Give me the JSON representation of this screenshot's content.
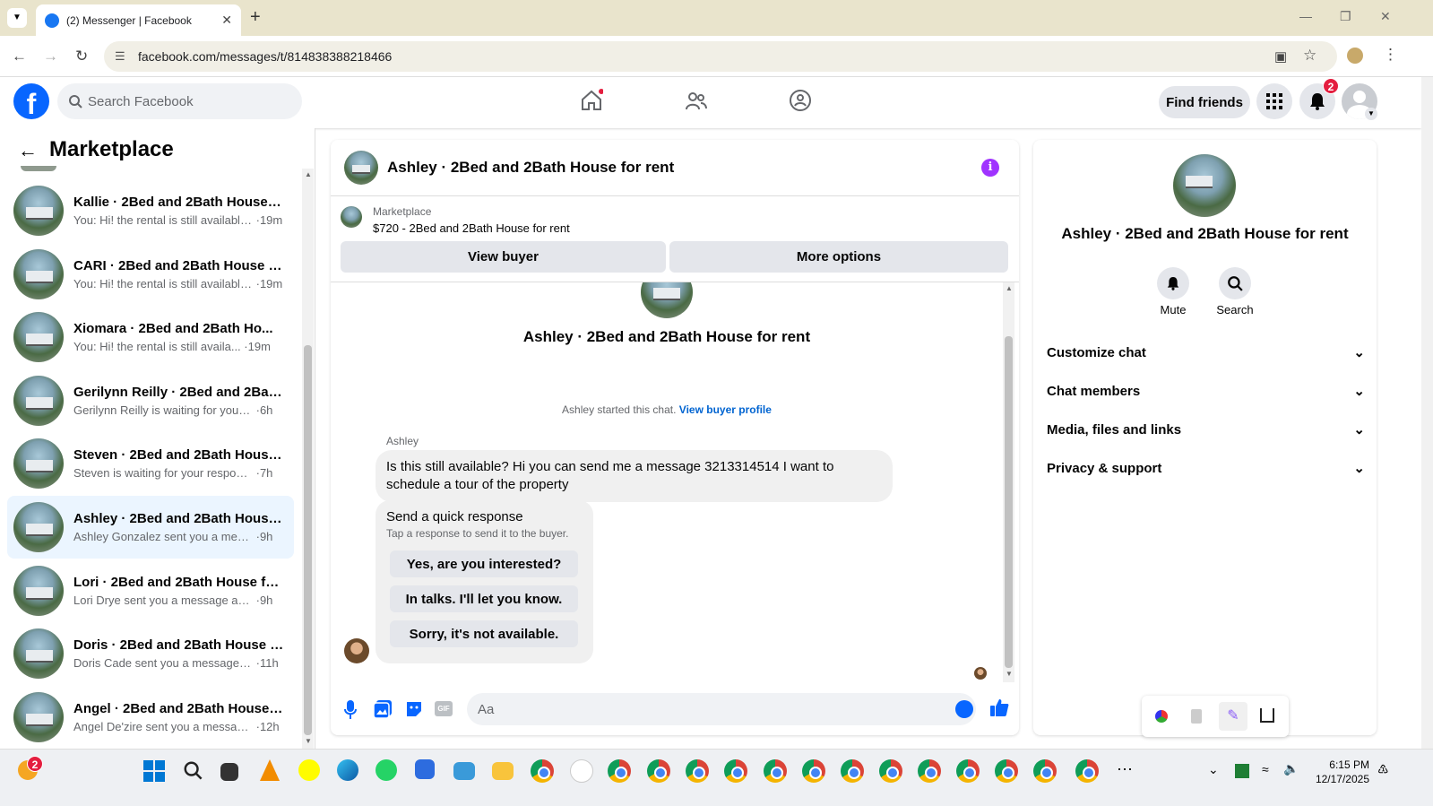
{
  "browser": {
    "tab_title": "(2) Messenger | Facebook",
    "url": "facebook.com/messages/t/814838388218466"
  },
  "fb_header": {
    "search_placeholder": "Search Facebook",
    "find_friends": "Find friends",
    "notifications_count": "2"
  },
  "sidebar": {
    "title": "Marketplace",
    "conversations": [
      {
        "name": "Kallie · 2Bed and 2Bath House f...",
        "preview": "You: Hi! the rental is still available...",
        "time": "19m",
        "selected": false
      },
      {
        "name": "CARI · 2Bed and 2Bath House fo...",
        "preview": "You: Hi! the rental is still available...",
        "time": "19m",
        "selected": false
      },
      {
        "name": "Xiomara · 2Bed and 2Bath Ho...",
        "preview": "You: Hi! the rental is still availa...",
        "time": "19m",
        "selected": false
      },
      {
        "name": "Gerilynn Reilly · 2Bed and 2Bath...",
        "preview": "Gerilynn Reilly is waiting for your r...",
        "time": "6h",
        "selected": false
      },
      {
        "name": "Steven · 2Bed and 2Bath House ...",
        "preview": "Steven is waiting for your response.",
        "time": "7h",
        "selected": false
      },
      {
        "name": "Ashley · 2Bed and 2Bath House ...",
        "preview": "Ashley Gonzalez sent you a messa...",
        "time": "9h",
        "selected": true
      },
      {
        "name": "Lori · 2Bed and 2Bath House for...",
        "preview": "Lori Drye sent you a message abou...",
        "time": "9h",
        "selected": false
      },
      {
        "name": "Doris · 2Bed and 2Bath House f...",
        "preview": "Doris Cade sent you a message a...",
        "time": "11h",
        "selected": false
      },
      {
        "name": "Angel · 2Bed and 2Bath House f...",
        "preview": "Angel De'zire sent you a message...",
        "time": "12h",
        "selected": false
      }
    ]
  },
  "chat": {
    "title": "Ashley · 2Bed and 2Bath House for rent",
    "listing_source": "Marketplace",
    "listing": "$720 - 2Bed and 2Bath House for rent",
    "view_buyer": "View buyer",
    "more_options": "More options",
    "center_name": "Ashley · 2Bed and 2Bath House for rent",
    "started_text": "Ashley started this chat.",
    "view_buyer_profile": "View buyer profile",
    "sender": "Ashley",
    "message": "Is this still available? Hi you can send me a message 3213314514 I want to schedule a tour of the property",
    "quick_title": "Send a quick response",
    "quick_sub": "Tap a response to send it to the buyer.",
    "quick_options": [
      "Yes, are you interested?",
      "In talks. I'll let you know.",
      "Sorry, it's not available."
    ],
    "composer_placeholder": "Aa"
  },
  "info_panel": {
    "name": "Ashley · 2Bed and 2Bath House for rent",
    "mute": "Mute",
    "search": "Search",
    "sections": [
      "Customize chat",
      "Chat members",
      "Media, files and links",
      "Privacy & support"
    ]
  },
  "taskbar": {
    "time": "6:15 PM",
    "date": "12/17/2025",
    "weather_badge": "2"
  }
}
